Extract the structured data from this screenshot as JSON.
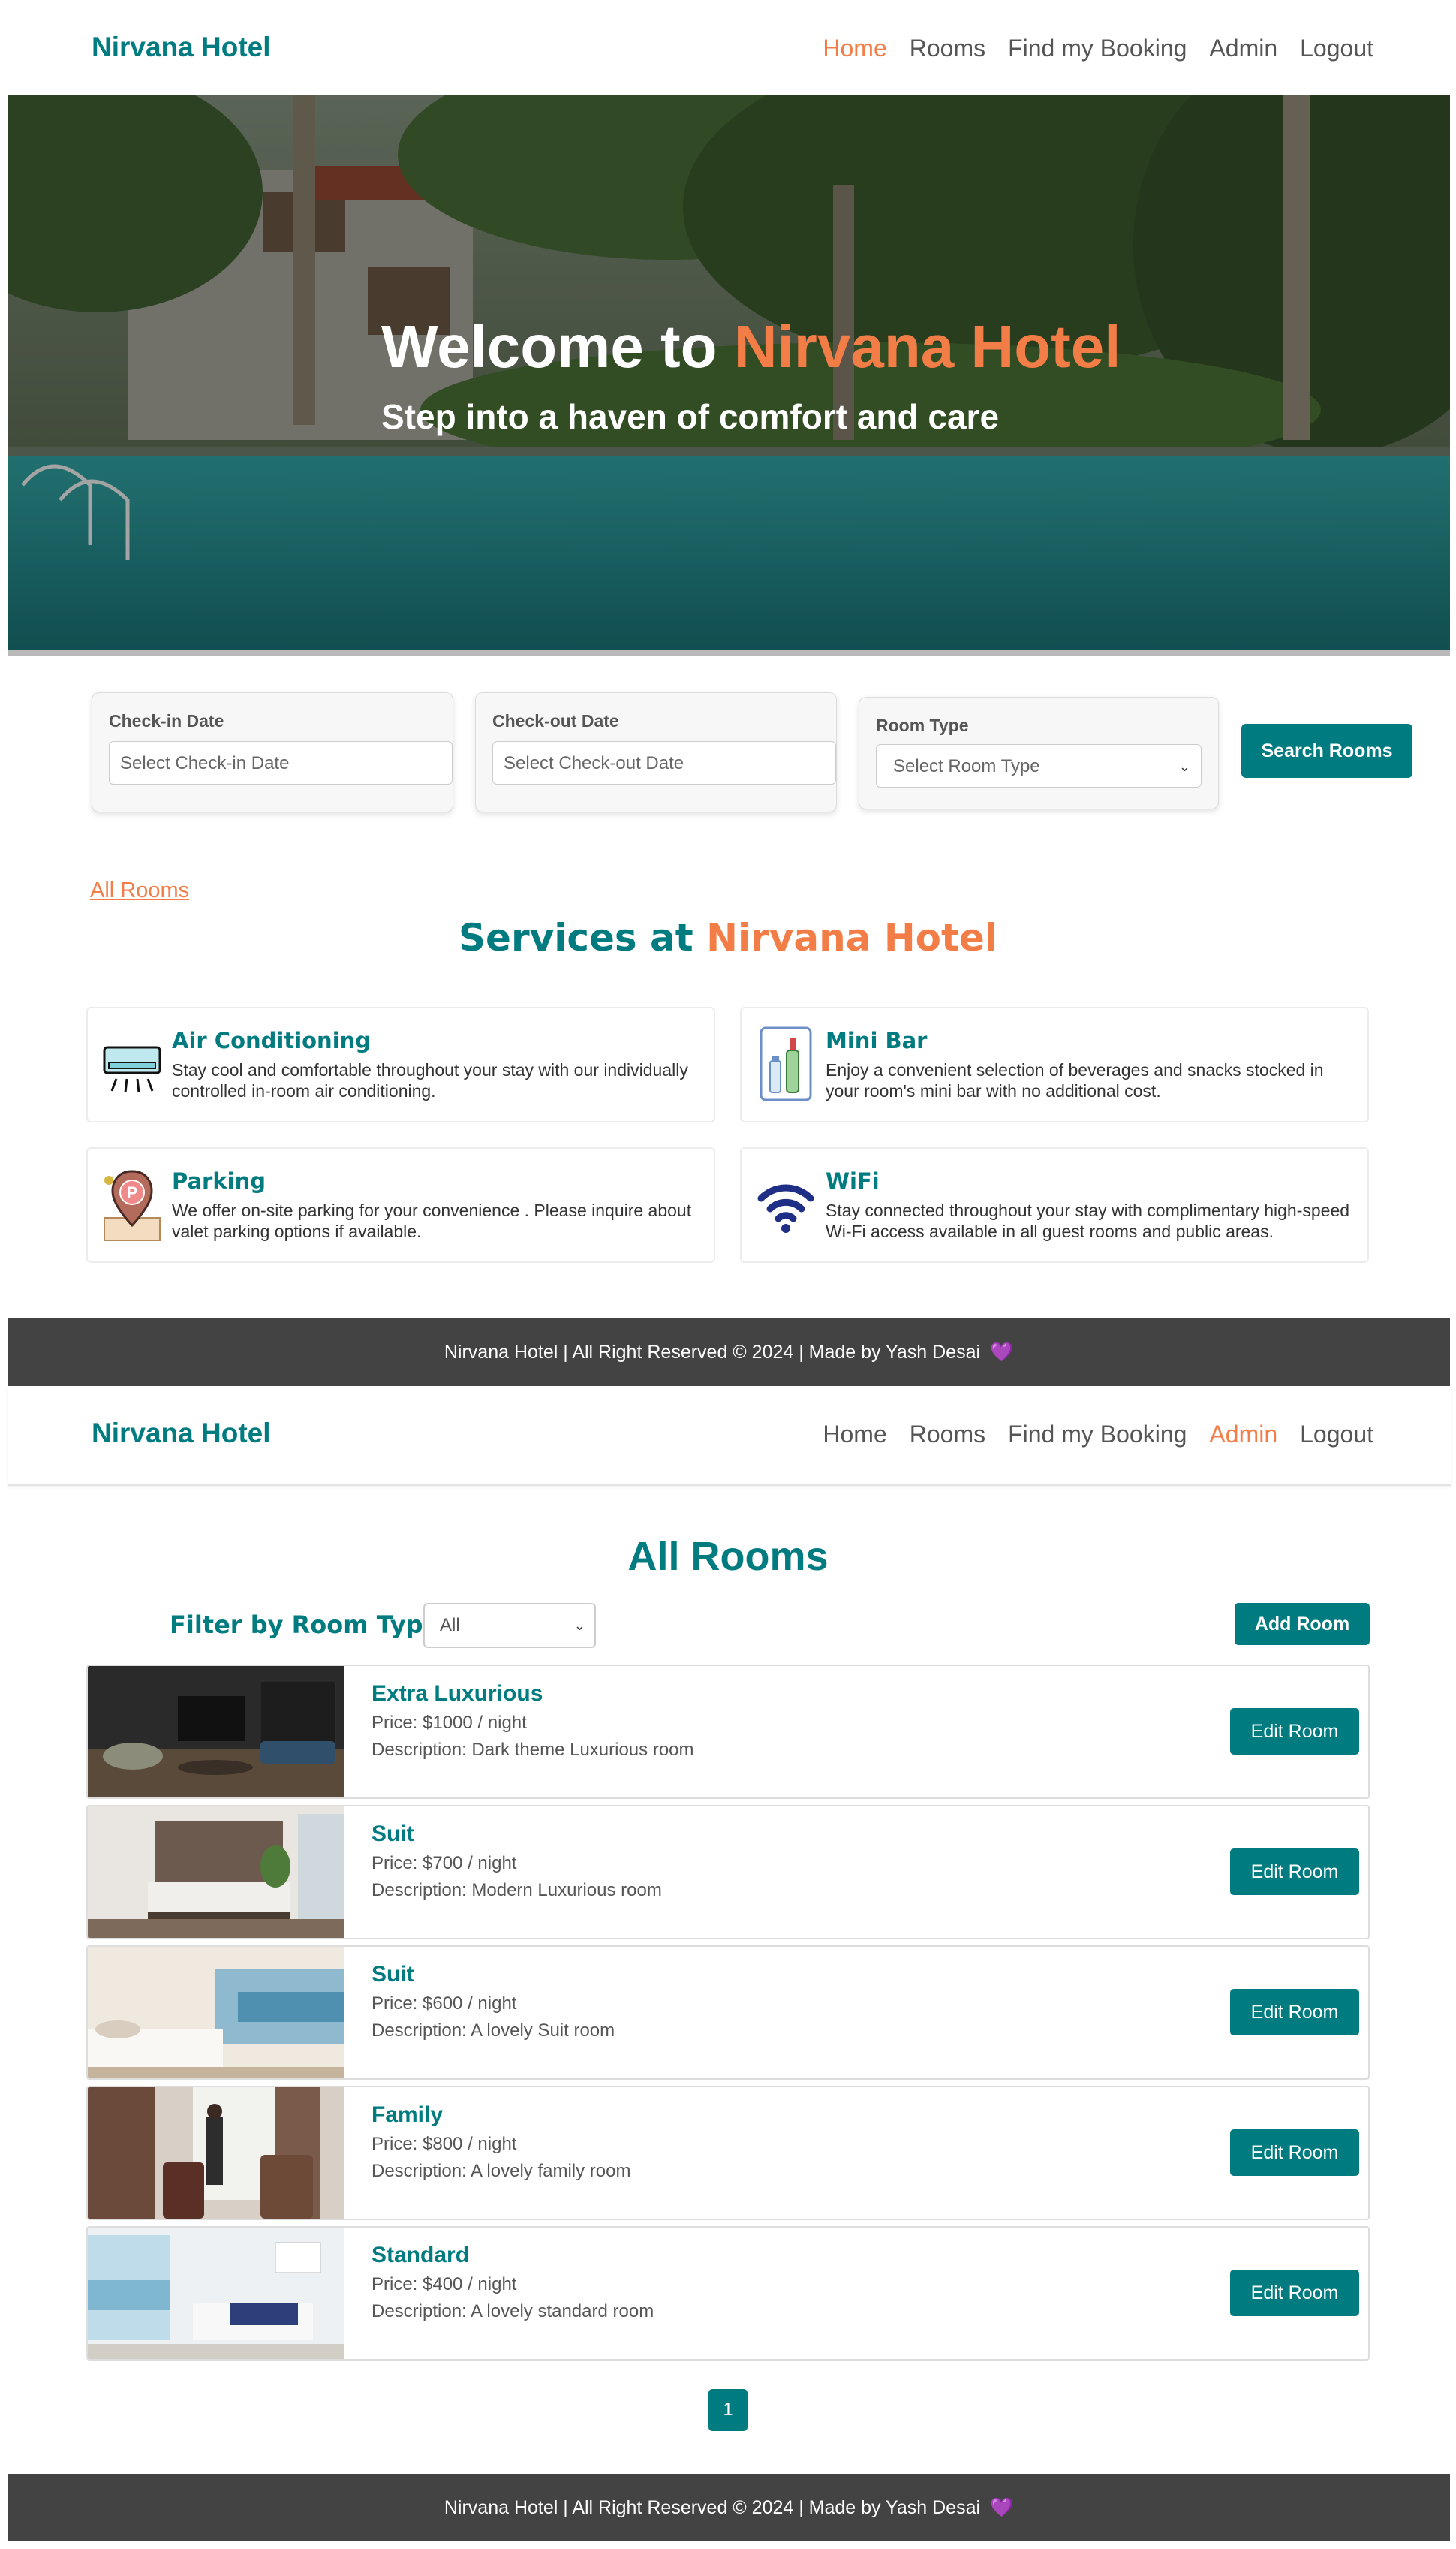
{
  "nav1": {
    "brand": "Nirvana Hotel",
    "links": [
      "Home",
      "Rooms",
      "Find my Booking",
      "Admin",
      "Logout"
    ]
  },
  "hero": {
    "title_prefix": "Welcome to",
    "title_accent": "Nirvana Hotel",
    "subtitle": "Step into a haven of comfort and care"
  },
  "search": {
    "checkin_label": "Check-in Date",
    "checkin_placeholder": "Select Check-in Date",
    "checkout_label": "Check-out Date",
    "checkout_placeholder": "Select Check-out Date",
    "roomtype_label": "Room Type",
    "roomtype_value": "Select Room Type",
    "button": "Search Rooms"
  },
  "all_rooms_link": "All Rooms",
  "services": {
    "title_prefix": "Services at",
    "title_accent": "Nirvana Hotel",
    "items": [
      {
        "name": "Air Conditioning",
        "desc": "Stay cool and comfortable throughout your stay with our individually controlled in-room air conditioning.",
        "icon": "air-conditioner-icon"
      },
      {
        "name": "Mini Bar",
        "desc": "Enjoy a convenient selection of beverages and snacks stocked in your room's mini bar with no additional cost.",
        "icon": "mini-bar-icon"
      },
      {
        "name": "Parking",
        "desc": "We offer on-site parking for your convenience . Please inquire about valet parking options if available.",
        "icon": "parking-icon"
      },
      {
        "name": "WiFi",
        "desc": "Stay connected throughout your stay with complimentary high-speed Wi-Fi access available in all guest rooms and public areas.",
        "icon": "wifi-icon"
      }
    ]
  },
  "footer": {
    "text": "Nirvana Hotel | All Right Reserved © 2024 | Made by Yash Desai",
    "heart": "💜"
  },
  "nav2": {
    "brand": "Nirvana Hotel",
    "links": [
      "Home",
      "Rooms",
      "Find my Booking",
      "Admin",
      "Logout"
    ]
  },
  "rooms_page": {
    "title": "All Rooms",
    "filter_label": "Filter by Room Type:",
    "filter_value": "All",
    "add_button": "Add Room",
    "rooms": [
      {
        "type": "Extra Luxurious",
        "price": "Price: $1000 / night",
        "desc": "Description: Dark theme Luxurious room",
        "edit": "Edit Room"
      },
      {
        "type": "Suit",
        "price": "Price: $700 / night",
        "desc": "Description: Modern Luxurious room",
        "edit": "Edit Room"
      },
      {
        "type": "Suit",
        "price": "Price: $600 / night",
        "desc": "Description: A lovely Suit room",
        "edit": "Edit Room"
      },
      {
        "type": "Family",
        "price": "Price: $800 / night",
        "desc": "Description: A lovely family room",
        "edit": "Edit Room"
      },
      {
        "type": "Standard",
        "price": "Price: $400 / night",
        "desc": "Description: A lovely standard room",
        "edit": "Edit Room"
      }
    ],
    "page": "1"
  },
  "colors": {
    "brand": "#007b80",
    "accent": "#f37d47",
    "footer_bg": "#434343"
  }
}
